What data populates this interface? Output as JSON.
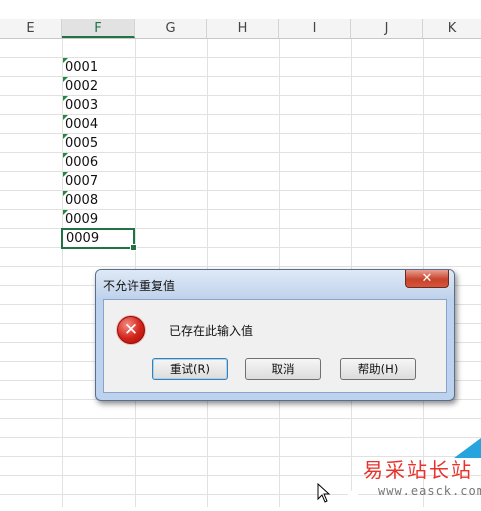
{
  "spreadsheet": {
    "columns": [
      "E",
      "F",
      "G",
      "H",
      "I",
      "J",
      "K"
    ],
    "active_column": "F",
    "cells": [
      "0001",
      "0002",
      "0003",
      "0004",
      "0005",
      "0006",
      "0007",
      "0008",
      "0009"
    ],
    "selected_cell_value": "0009",
    "number_stored_as_text_indicator_color": "#1e8a3e",
    "selection_color": "#217346"
  },
  "dialog": {
    "title": "不允许重复值",
    "close_label": "✕",
    "icon": "error-icon",
    "message": "已存在此输入值",
    "buttons": {
      "retry": "重试(R)",
      "cancel": "取消",
      "help": "帮助(H)"
    }
  },
  "watermark": {
    "title": "易采站长站",
    "url": "www.easck.com",
    "title_color": "#e8322b",
    "accent_color": "#27a4dd"
  }
}
